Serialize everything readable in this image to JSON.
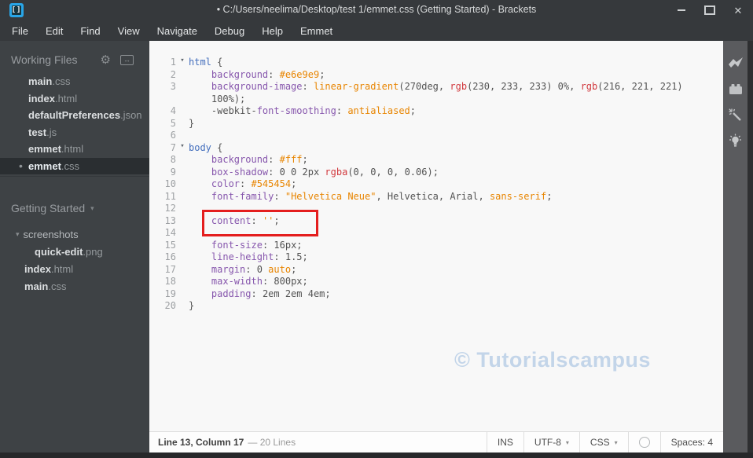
{
  "window": {
    "title": "• C:/Users/neelima/Desktop/test 1/emmet.css (Getting Started) - Brackets",
    "controls": [
      "minimize",
      "maximize",
      "close"
    ],
    "close_glyph": "✕",
    "logo_glyph": "[]"
  },
  "menu": {
    "items": [
      "File",
      "Edit",
      "Find",
      "View",
      "Navigate",
      "Debug",
      "Help",
      "Emmet"
    ]
  },
  "sidebar": {
    "working_files": {
      "title": "Working Files",
      "gear_glyph": "⚙",
      "split_glyph": "↔",
      "files": [
        {
          "base": "main",
          "ext": ".css",
          "selected": false,
          "dirty": false
        },
        {
          "base": "index",
          "ext": ".html",
          "selected": false,
          "dirty": false
        },
        {
          "base": "defaultPreferences",
          "ext": ".json",
          "selected": false,
          "dirty": false
        },
        {
          "base": "test",
          "ext": ".js",
          "selected": false,
          "dirty": false
        },
        {
          "base": "emmet",
          "ext": ".html",
          "selected": false,
          "dirty": false
        },
        {
          "base": "emmet",
          "ext": ".css",
          "selected": true,
          "dirty": true
        }
      ]
    },
    "project": {
      "name": "Getting Started",
      "dropdown_glyph": "▾",
      "tree": [
        {
          "type": "folder",
          "name": "screenshots",
          "indent": 1,
          "arrow": true
        },
        {
          "type": "file",
          "base": "quick-edit",
          "ext": ".png",
          "indent": 2
        },
        {
          "type": "file",
          "base": "index",
          "ext": ".html",
          "indent": 1
        },
        {
          "type": "file",
          "base": "main",
          "ext": ".css",
          "indent": 1
        }
      ]
    }
  },
  "editor": {
    "watermark": "© Tutorialscampus",
    "fold_glyph": "▾",
    "highlighted_line": 13,
    "rows": [
      {
        "num": "1",
        "fold": true,
        "tokens": [
          {
            "t": "html",
            "c": "t"
          },
          {
            "t": " {",
            "c": "d"
          }
        ]
      },
      {
        "num": "2",
        "tokens": [
          {
            "t": "    ",
            "c": "d"
          },
          {
            "t": "background",
            "c": "p"
          },
          {
            "t": ": ",
            "c": "d"
          },
          {
            "t": "#e6e9e9",
            "c": "a"
          },
          {
            "t": ";",
            "c": "d"
          }
        ]
      },
      {
        "num": "3",
        "tokens": [
          {
            "t": "    ",
            "c": "d"
          },
          {
            "t": "background-image",
            "c": "p"
          },
          {
            "t": ": ",
            "c": "d"
          },
          {
            "t": "linear-gradient",
            "c": "a"
          },
          {
            "t": "(",
            "c": "d"
          },
          {
            "t": "270deg",
            "c": "n"
          },
          {
            "t": ", ",
            "c": "d"
          },
          {
            "t": "rgb",
            "c": "r"
          },
          {
            "t": "(",
            "c": "d"
          },
          {
            "t": "230, 233, 233",
            "c": "n"
          },
          {
            "t": ") ",
            "c": "d"
          },
          {
            "t": "0%",
            "c": "n"
          },
          {
            "t": ", ",
            "c": "d"
          },
          {
            "t": "rgb",
            "c": "r"
          },
          {
            "t": "(",
            "c": "d"
          },
          {
            "t": "216, 221, 221",
            "c": "n"
          },
          {
            "t": ")",
            "c": "d"
          }
        ]
      },
      {
        "num": "",
        "tokens": [
          {
            "t": "    ",
            "c": "d"
          },
          {
            "t": "100%",
            "c": "n"
          },
          {
            "t": ");",
            "c": "d"
          }
        ]
      },
      {
        "num": "4",
        "tokens": [
          {
            "t": "    ",
            "c": "d"
          },
          {
            "t": "-webkit-",
            "c": "d"
          },
          {
            "t": "font-smoothing",
            "c": "p"
          },
          {
            "t": ": ",
            "c": "d"
          },
          {
            "t": "antialiased",
            "c": "a"
          },
          {
            "t": ";",
            "c": "d"
          }
        ]
      },
      {
        "num": "5",
        "tokens": [
          {
            "t": "}",
            "c": "d"
          }
        ]
      },
      {
        "num": "6",
        "tokens": []
      },
      {
        "num": "7",
        "fold": true,
        "tokens": [
          {
            "t": "body",
            "c": "t"
          },
          {
            "t": " {",
            "c": "d"
          }
        ]
      },
      {
        "num": "8",
        "tokens": [
          {
            "t": "    ",
            "c": "d"
          },
          {
            "t": "background",
            "c": "p"
          },
          {
            "t": ": ",
            "c": "d"
          },
          {
            "t": "#fff",
            "c": "a"
          },
          {
            "t": ";",
            "c": "d"
          }
        ]
      },
      {
        "num": "9",
        "tokens": [
          {
            "t": "    ",
            "c": "d"
          },
          {
            "t": "box-shadow",
            "c": "p"
          },
          {
            "t": ": ",
            "c": "d"
          },
          {
            "t": "0 0 2px ",
            "c": "n"
          },
          {
            "t": "rgba",
            "c": "r"
          },
          {
            "t": "(",
            "c": "d"
          },
          {
            "t": "0, 0, 0, 0.06",
            "c": "n"
          },
          {
            "t": ");",
            "c": "d"
          }
        ]
      },
      {
        "num": "10",
        "tokens": [
          {
            "t": "    ",
            "c": "d"
          },
          {
            "t": "color",
            "c": "p"
          },
          {
            "t": ": ",
            "c": "d"
          },
          {
            "t": "#545454",
            "c": "a"
          },
          {
            "t": ";",
            "c": "d"
          }
        ]
      },
      {
        "num": "11",
        "tokens": [
          {
            "t": "    ",
            "c": "d"
          },
          {
            "t": "font-family",
            "c": "p"
          },
          {
            "t": ": ",
            "c": "d"
          },
          {
            "t": "\"Helvetica Neue\"",
            "c": "a"
          },
          {
            "t": ", Helvetica, Arial, ",
            "c": "d"
          },
          {
            "t": "sans-serif",
            "c": "a"
          },
          {
            "t": ";",
            "c": "d"
          }
        ]
      },
      {
        "num": "12",
        "tokens": []
      },
      {
        "num": "13",
        "tokens": [
          {
            "t": "    ",
            "c": "d"
          },
          {
            "t": "content",
            "c": "p"
          },
          {
            "t": ": ",
            "c": "d"
          },
          {
            "t": "''",
            "c": "a"
          },
          {
            "t": ";",
            "c": "d"
          }
        ]
      },
      {
        "num": "14",
        "tokens": []
      },
      {
        "num": "15",
        "tokens": [
          {
            "t": "    ",
            "c": "d"
          },
          {
            "t": "font-size",
            "c": "p"
          },
          {
            "t": ": ",
            "c": "d"
          },
          {
            "t": "16px",
            "c": "n"
          },
          {
            "t": ";",
            "c": "d"
          }
        ]
      },
      {
        "num": "16",
        "tokens": [
          {
            "t": "    ",
            "c": "d"
          },
          {
            "t": "line-height",
            "c": "p"
          },
          {
            "t": ": ",
            "c": "d"
          },
          {
            "t": "1.5",
            "c": "n"
          },
          {
            "t": ";",
            "c": "d"
          }
        ]
      },
      {
        "num": "17",
        "tokens": [
          {
            "t": "    ",
            "c": "d"
          },
          {
            "t": "margin",
            "c": "p"
          },
          {
            "t": ": ",
            "c": "d"
          },
          {
            "t": "0 ",
            "c": "n"
          },
          {
            "t": "auto",
            "c": "a"
          },
          {
            "t": ";",
            "c": "d"
          }
        ]
      },
      {
        "num": "18",
        "tokens": [
          {
            "t": "    ",
            "c": "d"
          },
          {
            "t": "max-width",
            "c": "p"
          },
          {
            "t": ": ",
            "c": "d"
          },
          {
            "t": "800px",
            "c": "n"
          },
          {
            "t": ";",
            "c": "d"
          }
        ]
      },
      {
        "num": "19",
        "tokens": [
          {
            "t": "    ",
            "c": "d"
          },
          {
            "t": "padding",
            "c": "p"
          },
          {
            "t": ": ",
            "c": "d"
          },
          {
            "t": "2em 2em 4em",
            "c": "n"
          },
          {
            "t": ";",
            "c": "d"
          }
        ]
      },
      {
        "num": "20",
        "tokens": [
          {
            "t": "}",
            "c": "d"
          }
        ]
      }
    ],
    "token_colors": {
      "property": "#8757ad",
      "tag": "#446fbd",
      "atom_string": "#e88501",
      "function_rgb": "#d1383d",
      "default": "#535353"
    }
  },
  "toolbar": {
    "icons": [
      "live-preview",
      "extension-manager",
      "magic-wand",
      "lightbulb"
    ]
  },
  "statusbar": {
    "cursor_position": "Line 13, Column 17",
    "lines_info": "— 20 Lines",
    "right": [
      {
        "label": "INS"
      },
      {
        "label": "UTF-8",
        "dropdown": true
      },
      {
        "label": "CSS",
        "dropdown": true
      },
      {
        "icon": "lint-status-circle"
      },
      {
        "label": "Spaces:  4"
      }
    ],
    "dropdown_glyph": "▾"
  }
}
